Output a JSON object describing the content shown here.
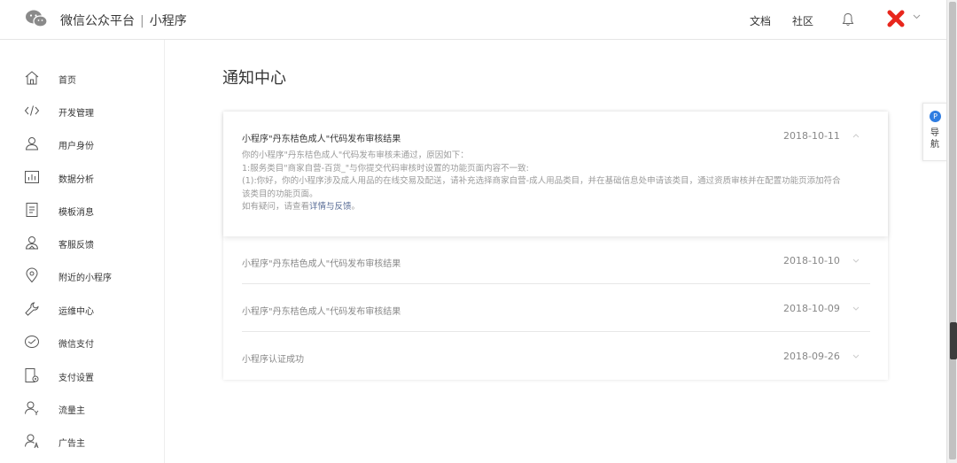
{
  "header": {
    "brand": "微信公众平台",
    "separator": "|",
    "section": "小程序",
    "links": [
      "文档",
      "社区"
    ],
    "icons": [
      "wechat-logo-icon",
      "bell-icon",
      "avatar-icon",
      "chevron-down-icon"
    ]
  },
  "sidebar": {
    "items": [
      {
        "label": "首页",
        "icon": "home-icon"
      },
      {
        "label": "开发管理",
        "icon": "code-icon"
      },
      {
        "label": "用户身份",
        "icon": "user-icon"
      },
      {
        "label": "数据分析",
        "icon": "bar-chart-icon"
      },
      {
        "label": "模板消息",
        "icon": "template-icon"
      },
      {
        "label": "客服反馈",
        "icon": "service-icon"
      },
      {
        "label": "附近的小程序",
        "icon": "location-icon"
      },
      {
        "label": "运维中心",
        "icon": "wrench-icon"
      },
      {
        "label": "微信支付",
        "icon": "wechat-pay-icon"
      },
      {
        "label": "支付设置",
        "icon": "payment-settings-icon"
      },
      {
        "label": "流量主",
        "icon": "traffic-owner-icon"
      },
      {
        "label": "广告主",
        "icon": "advertiser-icon"
      }
    ]
  },
  "main": {
    "title": "通知中心",
    "messages": [
      {
        "title": "小程序\"丹东桔色成人\"代码发布审核结果",
        "date": "2018-10-11",
        "expanded": true,
        "body": [
          "你的小程序\"丹东桔色成人\"代码发布审核未通过，原因如下：",
          "1:服务类目\"商家自营-百货_\"与你提交代码审核时设置的功能页面内容不一致:",
          "(1):你好，你的小程序涉及成人用品的在线交易及配送，请补充选择商家自营-成人用品类目，并在基础信息处申请该类目，通过资质审核并在配置功能页添加符合该类目的功能页面。"
        ],
        "footer_prefix": "如有疑问，请查看",
        "footer_link": "详情与反馈",
        "footer_suffix": "。"
      },
      {
        "title": "小程序\"丹东桔色成人\"代码发布审核结果",
        "date": "2018-10-10",
        "expanded": false
      },
      {
        "title": "小程序\"丹东桔色成人\"代码发布审核结果",
        "date": "2018-10-09",
        "expanded": false
      },
      {
        "title": "小程序认证成功",
        "date": "2018-09-26",
        "expanded": false
      }
    ]
  },
  "side_tab": {
    "badge": "P",
    "label": "导航"
  },
  "colors": {
    "accent": "#2f7de1",
    "link": "#576b95",
    "avatar": "#e8261c"
  }
}
